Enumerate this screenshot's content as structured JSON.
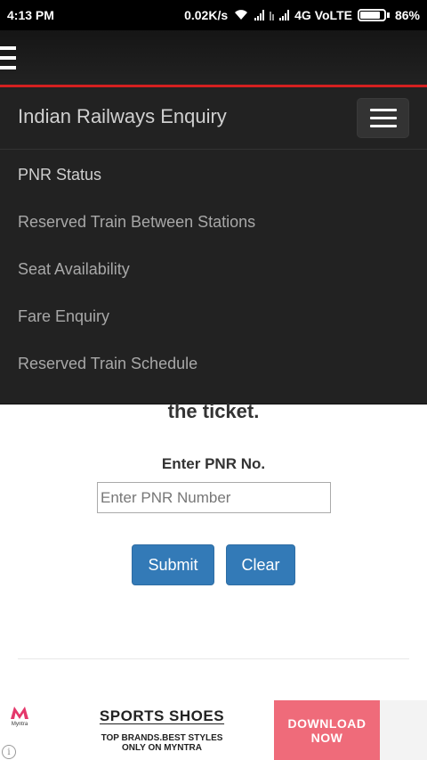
{
  "status_bar": {
    "time": "4:13 PM",
    "speed": "0.02K/s",
    "network": "4G VoLTE",
    "battery": "86%"
  },
  "navbar": {
    "brand": "Indian Railways Enquiry",
    "items": [
      {
        "label": "PNR Status"
      },
      {
        "label": "Reserved Train Between Stations"
      },
      {
        "label": "Seat Availability"
      },
      {
        "label": "Fare Enquiry"
      },
      {
        "label": "Reserved Train Schedule"
      }
    ]
  },
  "content": {
    "partial_heading": "the ticket.",
    "pnr_label": "Enter PNR No.",
    "pnr_placeholder": "Enter PNR Number",
    "submit_label": "Submit",
    "clear_label": "Clear"
  },
  "ad": {
    "brand": "Myntra",
    "headline": "SPORTS SHOES",
    "sub_line1": "TOP BRANDS.BEST STYLES",
    "sub_line2": "ONLY ON MYNTRA",
    "cta_line1": "DOWNLOAD",
    "cta_line2": "NOW"
  },
  "colors": {
    "navbar_bg": "#222222",
    "accent_red": "#d42020",
    "button_blue": "#337ab7",
    "ad_cta": "#ef6b7a"
  }
}
